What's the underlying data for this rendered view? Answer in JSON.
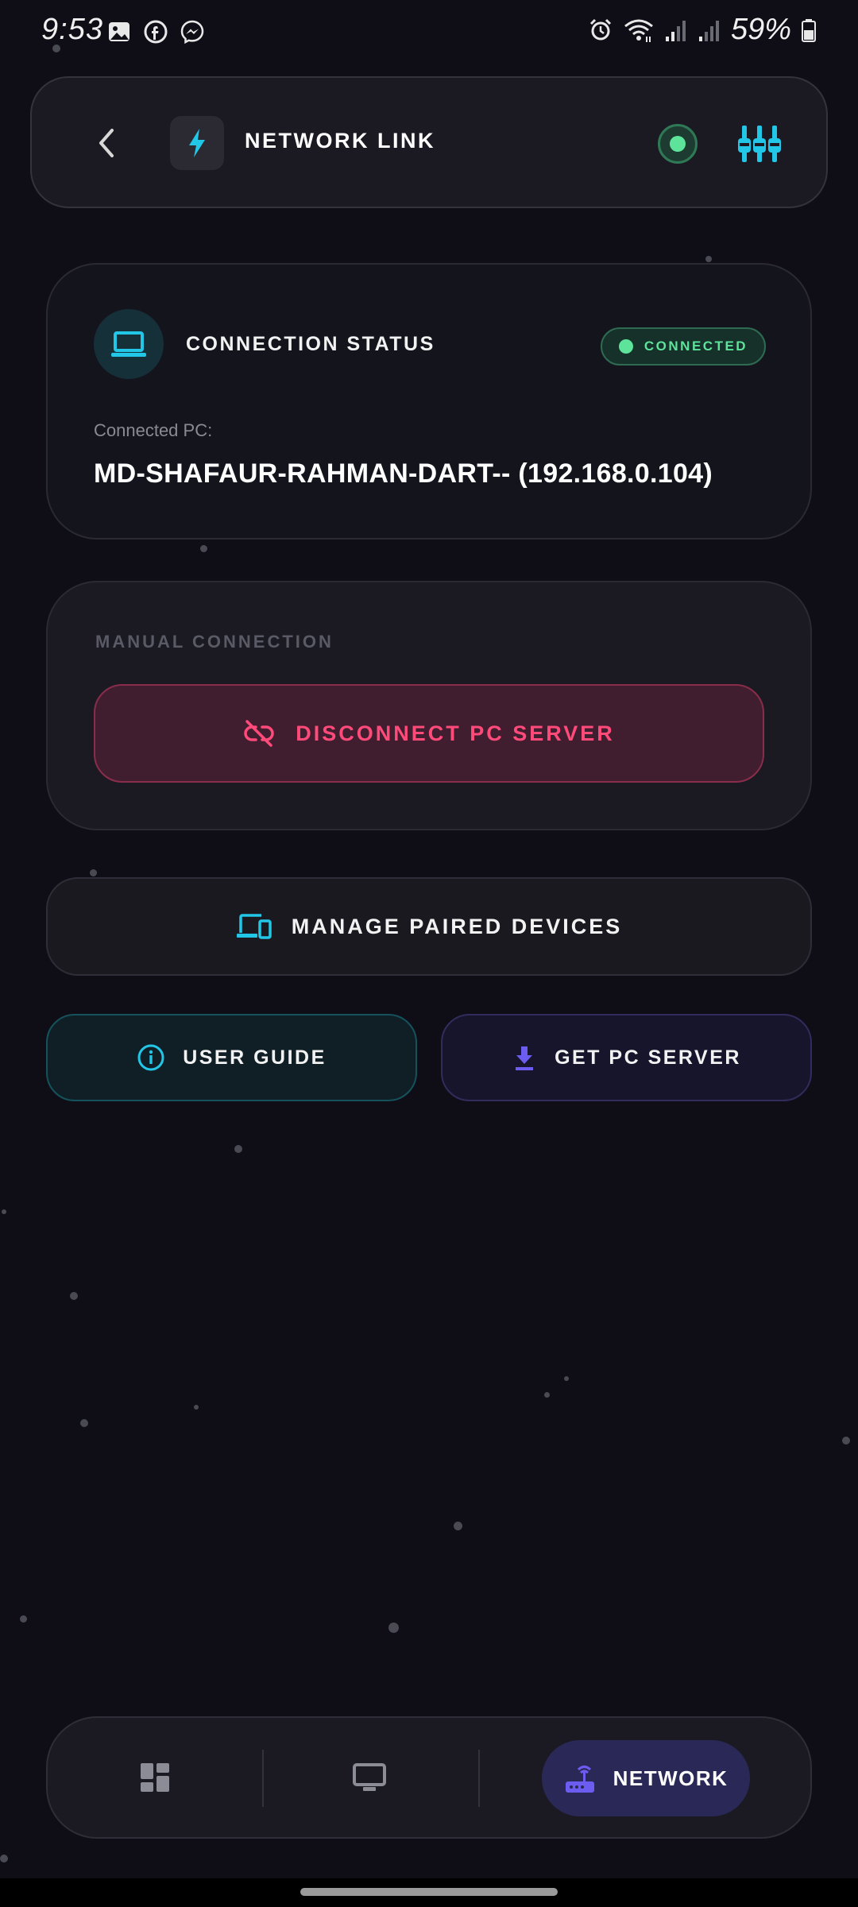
{
  "status_bar": {
    "time": "9:53",
    "battery": "59%",
    "icons": [
      "gallery-icon",
      "facebook-icon",
      "messenger-icon",
      "alarm-icon",
      "wifi-icon",
      "signal-icon",
      "signal-icon",
      "battery-icon"
    ]
  },
  "header": {
    "title": "NETWORK LINK",
    "status_color": "#5ee39b",
    "icons": [
      "back-icon",
      "bolt-icon",
      "status-indicator",
      "equalizer-icon"
    ]
  },
  "connection_status": {
    "title": "CONNECTION STATUS",
    "badge": "CONNECTED",
    "connected_label": "Connected PC:",
    "connected_pc": "MD-SHAFAUR-RAHMAN-DART-- (192.168.0.104)"
  },
  "manual_connection": {
    "title": "MANUAL CONNECTION",
    "disconnect_label": "DISCONNECT PC SERVER"
  },
  "actions": {
    "manage_paired_label": "MANAGE PAIRED DEVICES",
    "user_guide_label": "USER GUIDE",
    "get_pc_server_label": "GET PC SERVER"
  },
  "bottom_nav": {
    "items": [
      {
        "icon": "dashboard-icon",
        "label": ""
      },
      {
        "icon": "monitor-icon",
        "label": ""
      },
      {
        "icon": "router-icon",
        "label": "NETWORK",
        "active": true
      }
    ]
  },
  "colors": {
    "background": "#0f0e17",
    "accent_cyan": "#22c7e8",
    "accent_green": "#5ee39b",
    "danger": "#ff4a7a",
    "accent_purple": "#6c5cf0"
  }
}
